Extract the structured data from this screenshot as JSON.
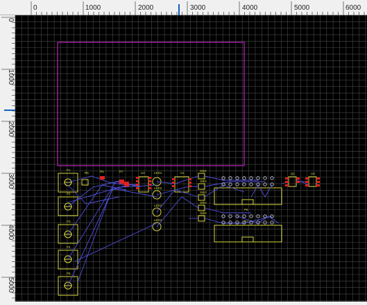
{
  "rulers": {
    "horizontal_labels": [
      "0",
      "1000",
      "2000",
      "3000",
      "4000",
      "5000",
      "6000"
    ],
    "vertical_labels": [
      "0",
      "1000",
      "2000",
      "3000",
      "4000",
      "5000"
    ]
  },
  "colors": {
    "background": "#000000",
    "grid": "#4a4a4a",
    "board_outline": "#c020c0",
    "silkscreen": "#d8d840",
    "ratsnest": "#5050e0",
    "pad": "#e02020",
    "ruler_marker": "#1060c0"
  },
  "components": {
    "P1": "P1",
    "P2": "P2",
    "P3": "P3",
    "P4": "P4",
    "P5": "P5",
    "R5": "R5",
    "R6": "R6",
    "R7": "R7",
    "U2": "U2",
    "LED1": "LED1",
    "LED2": "LED2",
    "LED3": "LED3",
    "LED4": "LED4",
    "U1": "U1",
    "SW1": "SW1",
    "SW2": "SW2",
    "SW3": "SW3",
    "SW4": "SW4",
    "SW5": "SW5",
    "P6": "P6",
    "P7": "P7",
    "Q1": "Q1",
    "U3": "U3"
  }
}
